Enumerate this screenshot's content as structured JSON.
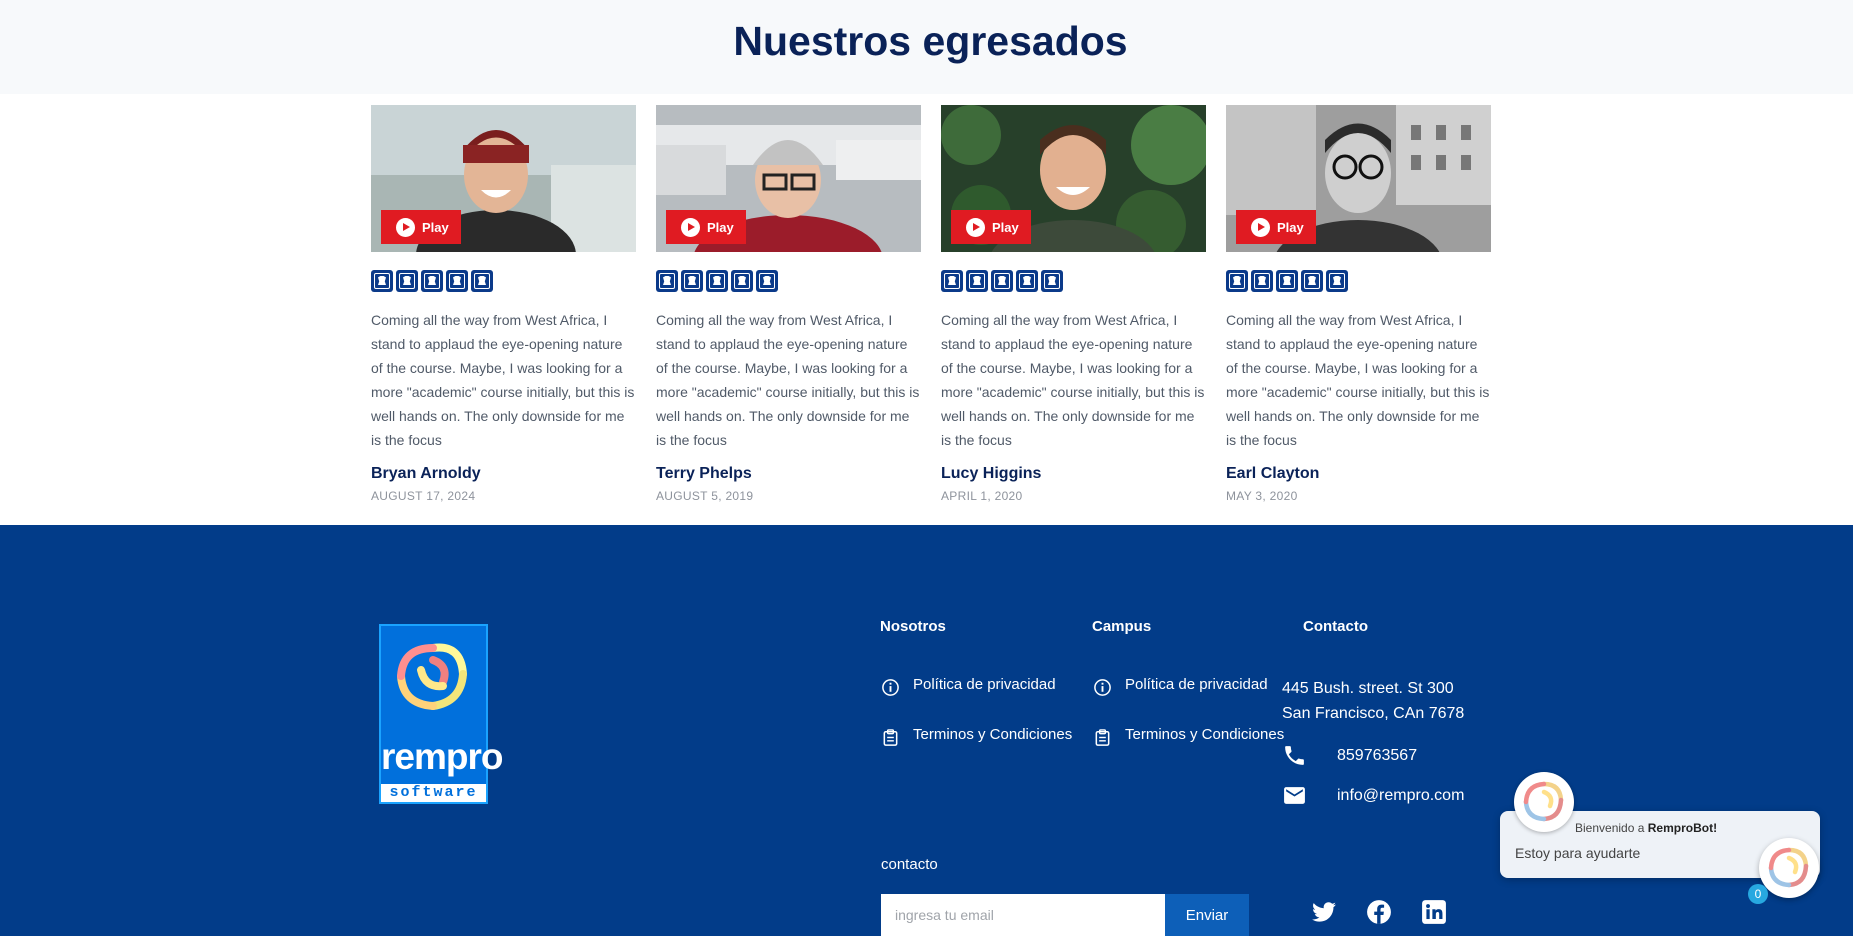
{
  "page": {
    "title": "Nuestros egresados"
  },
  "testimonials": [
    {
      "play_label": "Play",
      "rating": 5,
      "quote": "Coming all the way from West Africa, I stand to applaud the eye-opening nature of the course. Maybe, I was looking for a more \"academic\" course initially, but this is well hands on. The only downside for me is the focus",
      "name": "Bryan Arnoldy",
      "date": "AUGUST 17, 2024"
    },
    {
      "play_label": "Play",
      "rating": 5,
      "quote": "Coming all the way from West Africa, I stand to applaud the eye-opening nature of the course. Maybe, I was looking for a more \"academic\" course initially, but this is well hands on. The only downside for me is the focus",
      "name": "Terry Phelps",
      "date": "AUGUST 5, 2019"
    },
    {
      "play_label": "Play",
      "rating": 5,
      "quote": "Coming all the way from West Africa, I stand to applaud the eye-opening nature of the course. Maybe, I was looking for a more \"academic\" course initially, but this is well hands on. The only downside for me is the focus",
      "name": "Lucy Higgins",
      "date": "APRIL 1, 2020"
    },
    {
      "play_label": "Play",
      "rating": 5,
      "quote": "Coming all the way from West Africa, I stand to applaud the eye-opening nature of the course. Maybe, I was looking for a more \"academic\" course initially, but this is well hands on. The only downside for me is the focus",
      "name": "Earl Clayton",
      "date": "MAY 3, 2020"
    }
  ],
  "footer": {
    "logo": {
      "brand": "rempro",
      "sub": "software"
    },
    "nosotros": {
      "title": "Nosotros",
      "links": [
        "Política de privacidad",
        "Terminos y Condiciones"
      ]
    },
    "campus": {
      "title": "Campus",
      "links": [
        "Política de privacidad",
        "Terminos y Condiciones"
      ]
    },
    "contacto": {
      "title": "Contacto",
      "address_line1": "445 Bush. street. St 300",
      "address_line2": "San Francisco, CAn 7678",
      "phone": "859763567",
      "email": "info@rempro.com"
    },
    "newsletter": {
      "label": "contacto",
      "placeholder": "ingresa tu email",
      "button": "Enviar"
    },
    "social": [
      "twitter-icon",
      "facebook-icon",
      "linkedin-icon"
    ]
  },
  "chatbot": {
    "welcome_prefix": "Bienvenido a",
    "bot_name": "RemproBot!",
    "message": "Estoy para ayudarte",
    "badge_count": "0"
  },
  "colors": {
    "navy": "#0a2258",
    "footer_bg": "#023c89",
    "play_red": "#e01b22",
    "star_bg": "#0b3a8a",
    "logo_blue": "#0170dc"
  }
}
